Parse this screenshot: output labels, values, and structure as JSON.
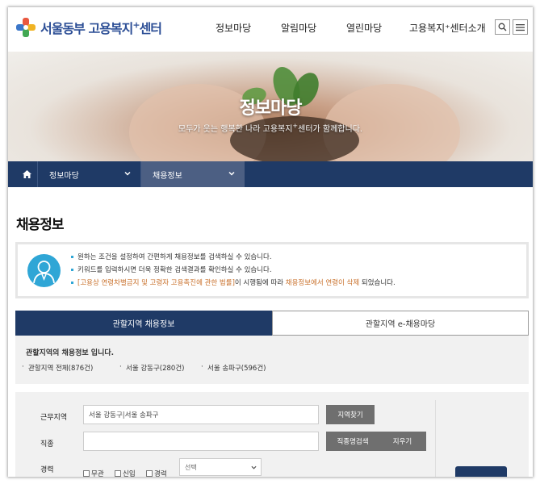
{
  "header": {
    "logo_text": "서울동부 고용복지",
    "logo_sup": "+",
    "logo_suffix": "센터",
    "nav": [
      "정보마당",
      "알림마당",
      "열린마당",
      "고용복지⁺센터소개"
    ],
    "icons": [
      "search-icon",
      "menu-icon"
    ]
  },
  "hero": {
    "title": "정보마당",
    "subtitle_pre": "모두가 웃는 행복한 나라 고용복지",
    "subtitle_sup": "+",
    "subtitle_post": "센터가 함께합니다."
  },
  "breadcrumb": {
    "home_icon": "home-icon",
    "level1": "정보마당",
    "level2": "채용정보"
  },
  "page_title": "채용정보",
  "info": {
    "line1": "원하는 조건을 설정하여 간편하게 채용정보를 검색하실 수 있습니다.",
    "line2": "키워드를 입력하시면 더욱 정확한 검색결과를 확인하실 수 있습니다.",
    "line3_a": "[고용상 연령차별금지 및 고령자 고용촉진에 관한 법률]",
    "line3_b": "이 시행됨에 따라 ",
    "line3_c": "채용정보에서 연령이 삭제",
    "line3_d": " 되었습니다."
  },
  "tabs": {
    "active": "관할지역 채용정보",
    "inactive": "관할지역 e-채용마당"
  },
  "region": {
    "title": "관할지역의 채용정보 입니다.",
    "links": [
      "관할지역 전체(876건)",
      "서울 강동구(280건)",
      "서울 송파구(596건)"
    ]
  },
  "form": {
    "work_area_label": "근무지역",
    "work_area_value": "서울 강동구|서울 송파구",
    "find_area_button": "지역찾기",
    "job_label": "직종",
    "job_value": "",
    "job_search_button": "직종명검색",
    "clear_button": "지우기",
    "career_label": "경력",
    "career_options": [
      "무관",
      "신입",
      "경력"
    ],
    "career_select": "선택"
  },
  "colors": {
    "navy": "#1f3a66",
    "accent_blue": "#2fa6d6",
    "orange": "#c9712c"
  }
}
